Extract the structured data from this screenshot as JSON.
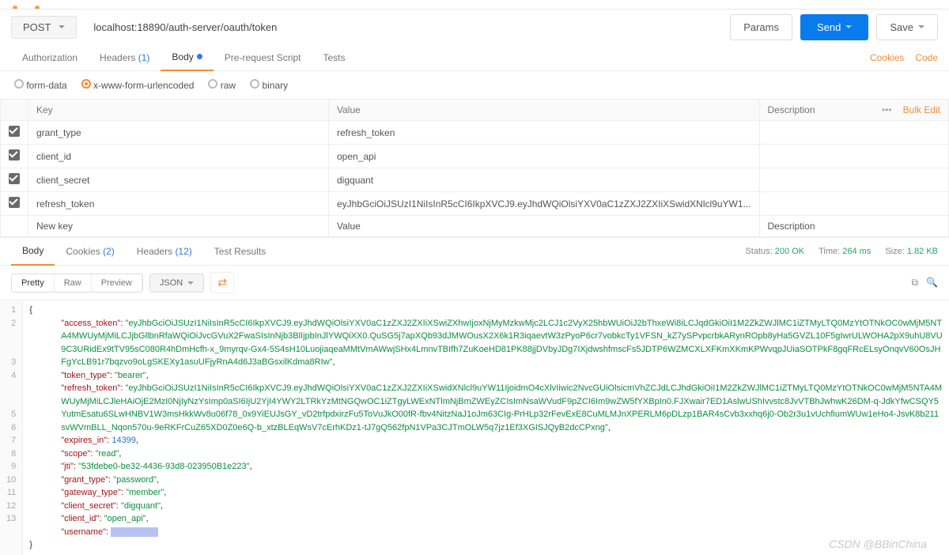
{
  "request": {
    "method": "POST",
    "url": "localhost:18890/auth-server/oauth/token",
    "params_btn": "Params",
    "send_btn": "Send",
    "save_btn": "Save"
  },
  "subtabs": {
    "authorization": "Authorization",
    "headers": "Headers",
    "headers_count": "(1)",
    "body": "Body",
    "prerequest": "Pre-request Script",
    "tests": "Tests",
    "cookies": "Cookies",
    "code": "Code"
  },
  "bodytypes": {
    "formdata": "form-data",
    "urlencoded": "x-www-form-urlencoded",
    "raw": "raw",
    "binary": "binary"
  },
  "table": {
    "h_key": "Key",
    "h_value": "Value",
    "h_desc": "Description",
    "bulk": "Bulk Edit",
    "new_key": "New key",
    "new_val": "Value",
    "new_desc": "Description",
    "rows": [
      {
        "key": "grant_type",
        "value": "refresh_token"
      },
      {
        "key": "client_id",
        "value": "open_api"
      },
      {
        "key": "client_secret",
        "value": "digquant"
      },
      {
        "key": "refresh_token",
        "value": "eyJhbGciOiJSUzI1NiIsInR5cCI6IkpXVCJ9.eyJhdWQiOlsiYXV0aC1zZXJ2ZXIiXSwidXNlcl9uYW1..."
      }
    ]
  },
  "response": {
    "tab_body": "Body",
    "tab_cookies": "Cookies",
    "cookies_count": "(2)",
    "tab_headers": "Headers",
    "headers_count": "(12)",
    "tab_results": "Test Results",
    "status_label": "Status:",
    "status_value": "200 OK",
    "time_label": "Time:",
    "time_value": "264 ms",
    "size_label": "Size:",
    "size_value": "1.82 KB",
    "pretty": "Pretty",
    "raw": "Raw",
    "preview": "Preview",
    "json": "JSON"
  },
  "json_body": {
    "access_token": "eyJhbGciOiJSUzI1NiIsInR5cCI6IkpXVCJ9.eyJhdWQiOlsiYXV0aC1zZXJ2ZXIiXSwiZXhwIjoxNjMyMzkwMjc2LCJ1c2VyX25hbWUiOiJ2bThxeWi8iLCJqdGkiOiI1M2ZkZWJlMC1iZTMyLTQ0MzYtOTNkOC0wMjM5NTA4MWUyMjMiLCJjbGllbnRfaWQiOiJvcGVuX2FwaSIsInNjb3BlIjpbInJlYWQiXX0.QuSG5j7apXQb93dJMWOusX2X6k1R3iqaevtW3zPyoP6cr7vobkcTy1VFSN_kZ7ySPvpcrbkARynROpb8yHa5GVZL10F5gIwrULWOHA2pX9uhU8VU9C3URidEx9tTV95sC080R4hDmHcfh-x_9myrqv-Gx4-5S4sH10LuojiaqeaMMtVmAWwjSHx4LmnvTBIfh7ZuKoeHD81PK88jjDVbyJDg7IXjdwshfmscFs5JDTP6WZMCXLXFKmXKmKPWvqpJUiaSOTPkF8gqFRcELsyOnqvV60OsJHFgYcLB91r7bqzvo9oLgSKEXy1asuUFjyRnA4d6J3aBGsxilKdma8RIw",
    "token_type": "bearer",
    "refresh_token": "eyJhbGciOiJSUzI1NiIsInR5cCI6IkpXVCJ9.eyJhdWQiOlsiYXV0aC1zZXJ2ZXIiXSwidXNlcl9uYW11IjoidmO4cXlvIiwic2NvcGUiOlsicmVhZCJdLCJhdGkiOiI1M2ZkZWJlMC1iZTMyLTQ0MzYtOTNkOC0wMjM5NTA4MWUyMjMiLCJleHAiOjE2MzI0NjIyNzYsImp0aSI6IjU2YjI4YWY2LTRkYzMtNGQwOC1iZTgyLWExNTlmNjBmZWEyZCIsImNsaWVudF9pZCI6Im9wZW5fYXBpIn0.FJXwair7ED1AslwUShIvvstc8JvVTBhJwhwK26DM-q-JdkYfwCSQY5YutmEsatu6SLwHNBV1W3msHkkWv8u06f78_0x9YiEUJsGY_vD2trfpdxirzFu5ToVuJkO00fR-fbv4NitzNaJ1oJm63CIg-PrHLp32rFevExE8CuMLMJnXPERLM6pDLzp1BAR4sCvb3xxhq6j0-Ob2r3u1vUchfiumWUw1eHo4-JsvK8b211svWVmBLL_Nqon570u-9eRKFrCuZ65XD0Z0e6Q-b_xtzBLEqWsV7cErhKDz1-tJ7gQ562fpN1VPa3CJTmOLW5q7jz1Ef3XGISJQyB2dcCPxng",
    "expires_in": 14399,
    "scope": "read",
    "jti": "53fdebe0-be32-4436-93d8-023950B1e223",
    "grant_type": "password",
    "gateway_type": "member",
    "client_secret": "digquant",
    "client_id": "open_api",
    "username_key": "username"
  },
  "watermark": "CSDN @BBinChina"
}
